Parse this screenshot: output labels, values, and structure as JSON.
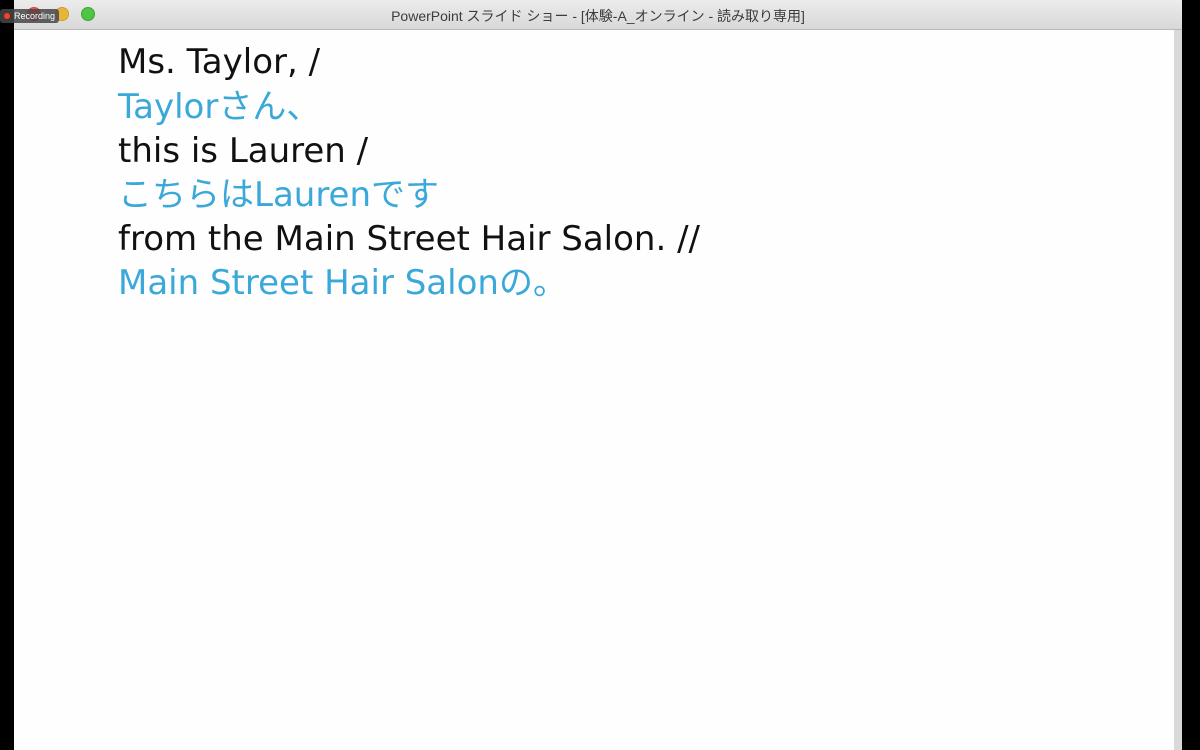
{
  "window": {
    "title": "PowerPoint スライド ショー - [体験-A_オンライン  -  読み取り専用]"
  },
  "overlay": {
    "recording_label": "Recording"
  },
  "slide": {
    "lines": [
      {
        "text": "Ms. Taylor, /",
        "lang": "en"
      },
      {
        "text": "Taylorさん、",
        "lang": "jp"
      },
      {
        "text": "this is Lauren /",
        "lang": "en"
      },
      {
        "text": "こちらはLaurenです",
        "lang": "jp"
      },
      {
        "text": "from the Main Street Hair Salon. //",
        "lang": "en"
      },
      {
        "text": "Main Street Hair Salonの。",
        "lang": "jp"
      }
    ]
  },
  "colors": {
    "english_text": "#111111",
    "japanese_text": "#3aa8d8",
    "slide_background": "#fefefe"
  }
}
